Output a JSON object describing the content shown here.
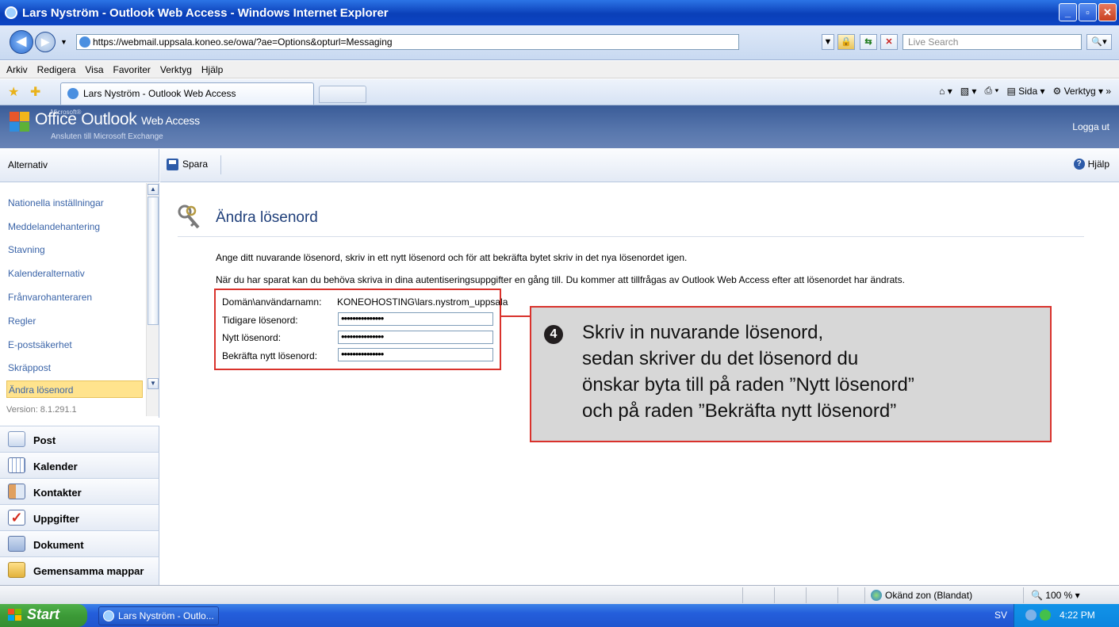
{
  "window": {
    "title": "Lars Nyström - Outlook Web Access - Windows Internet Explorer"
  },
  "addressbar": {
    "url": "https://webmail.uppsala.koneo.se/owa/?ae=Options&opturl=Messaging",
    "search_placeholder": "Live Search"
  },
  "menu": [
    "Arkiv",
    "Redigera",
    "Visa",
    "Favoriter",
    "Verktyg",
    "Hjälp"
  ],
  "tab": {
    "label": "Lars Nyström - Outlook Web Access"
  },
  "commandbar": {
    "page": "Sida",
    "tools": "Verktyg"
  },
  "owa": {
    "ms": "Microsoft®",
    "brand_main": "Office Outlook",
    "brand_sub": "Web Access",
    "subtitle": "Ansluten till Microsoft Exchange",
    "logout": "Logga ut"
  },
  "sidebar": {
    "title": "Alternativ",
    "items": [
      "Nationella inställningar",
      "Meddelandehantering",
      "Stavning",
      "Kalenderalternativ",
      "Frånvarohanteraren",
      "Regler",
      "E-postsäkerhet",
      "Skräppost",
      "Ändra lösenord"
    ],
    "version": "Version: 8.1.291.1"
  },
  "modules": [
    "Post",
    "Kalender",
    "Kontakter",
    "Uppgifter",
    "Dokument",
    "Gemensamma mappar"
  ],
  "toolbar": {
    "save": "Spara",
    "help": "Hjälp"
  },
  "page": {
    "title": "Ändra lösenord",
    "para1": "Ange ditt nuvarande lösenord, skriv in ett nytt lösenord och för att bekräfta bytet skriv in det nya lösenordet igen.",
    "para2": "När du har sparat kan du behöva skriva in dina autentiseringsuppgifter en gång till. Du kommer att tillfrågas av Outlook Web Access efter att lösenordet har ändrats."
  },
  "form": {
    "domain_label": "Domän\\användarnamn:",
    "domain_value": "KONEOHOSTING\\lars.nystrom_uppsala",
    "old_label": "Tidigare lösenord:",
    "old_value": "•••••••••••••••",
    "new_label": "Nytt lösenord:",
    "new_value": "•••••••••••••••",
    "confirm_label": "Bekräfta nytt lösenord:",
    "confirm_value": "•••••••••••••••"
  },
  "callout": {
    "number": "4",
    "lines": [
      "Skriv in nuvarande lösenord,",
      "sedan skriver du det lösenord du",
      "önskar byta till på raden ”Nytt lösenord”",
      "och på raden ”Bekräfta nytt lösenord”"
    ]
  },
  "status": {
    "zone": "Okänd zon (Blandat)",
    "zoom": "100 %"
  },
  "taskbar": {
    "start": "Start",
    "item": "Lars Nyström - Outlo...",
    "lang": "SV",
    "clock": "4:22 PM"
  },
  "colors": {
    "accent_red": "#d9322c",
    "owa_header": "#4a6aa3",
    "selected_item": "#ffe38d",
    "link": "#3a64a8"
  }
}
